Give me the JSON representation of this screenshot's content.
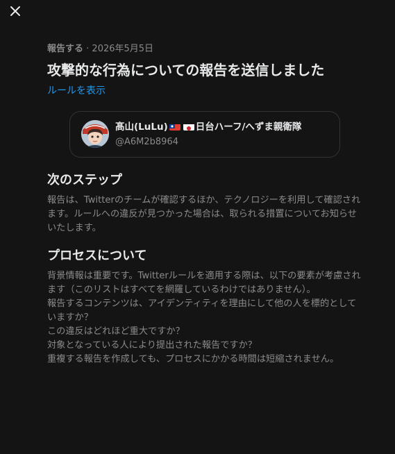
{
  "header": {
    "close_icon": "close-icon"
  },
  "meta": {
    "kind": "報告する",
    "separator": " · ",
    "date": "2026年5月5日"
  },
  "title": "攻撃的な行為についての報告を送信しました",
  "rules_link": "ルールを表示",
  "user_card": {
    "name_prefix": "髙山(LuLu)",
    "name_suffix": "日台ハーフ/へずま親衛隊",
    "flags": [
      "taiwan-flag-icon",
      "japan-flag-icon"
    ],
    "handle": "@A6M2b8964",
    "avatar": "avatar"
  },
  "next_steps": {
    "heading": "次のステップ",
    "body": "報告は、Twitterのチームが確認するほか、テクノロジーを利用して確認されます。ルールへの違反が見つかった場合は、取られる措置についてお知らせいたします。"
  },
  "process": {
    "heading": "プロセスについて",
    "lines": [
      "背景情報は重要です。Twitterルールを適用する際は、以下の要素が考慮されます（このリストはすべてを網羅しているわけではありません）。",
      "報告するコンテンツは、アイデンティティを理由にして他の人を標的としていますか？",
      "この違反はどれほど重大ですか？",
      "対象となっている人により提出された報告ですか？",
      "重複する報告を作成しても、プロセスにかかる時間は短縮されません。"
    ]
  },
  "colors": {
    "background": "#141414",
    "text_primary": "#e7e9ea",
    "text_secondary": "#8b8b8b",
    "link": "#1d9bf0",
    "border": "#333333"
  }
}
